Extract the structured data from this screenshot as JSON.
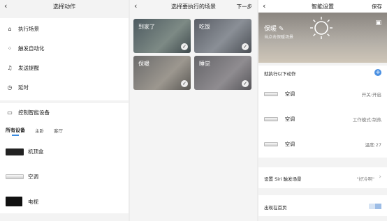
{
  "panel1": {
    "title": "选择动作",
    "actions": [
      {
        "icon": "home-icon",
        "label": "执行场景"
      },
      {
        "icon": "automation-icon",
        "label": "触发自动化"
      },
      {
        "icon": "bell-icon",
        "label": "发送提醒"
      },
      {
        "icon": "clock-icon",
        "label": "延时"
      }
    ],
    "control_label": "控制智能设备",
    "tabs": [
      "所有设备",
      "主卧",
      "客厅"
    ],
    "active_tab": "所有设备",
    "devices": [
      {
        "label": "机顶盒",
        "icon": "settop-box-icon"
      },
      {
        "label": "空调",
        "icon": "air-conditioner-icon"
      },
      {
        "label": "电视",
        "icon": "tv-icon"
      }
    ]
  },
  "panel2": {
    "title": "选择要执行的场景",
    "next": "下一步",
    "scenes": [
      {
        "label": "到家了",
        "checked": true
      },
      {
        "label": "吃饭",
        "checked": true
      },
      {
        "label": "保暖",
        "checked": true
      },
      {
        "label": "睡觉",
        "checked": true
      }
    ]
  },
  "panel3": {
    "title": "智能设置",
    "save": "保存",
    "scene_name": "保暖",
    "scene_hint": "当点击保暖场景",
    "exec_label": "就执行以下动作",
    "actions": [
      {
        "device": "空调",
        "value": "开关:开启"
      },
      {
        "device": "空调",
        "value": "工作模式:制热"
      },
      {
        "device": "空调",
        "value": "温度:27"
      }
    ],
    "siri_label": "设置 Siri 触发场景",
    "siri_value": "\"好冷啊\"",
    "home_label": "出现在首页",
    "home_toggle": true
  },
  "colors": {
    "accent": "#4a90e2",
    "background": "#f3f3f3"
  }
}
